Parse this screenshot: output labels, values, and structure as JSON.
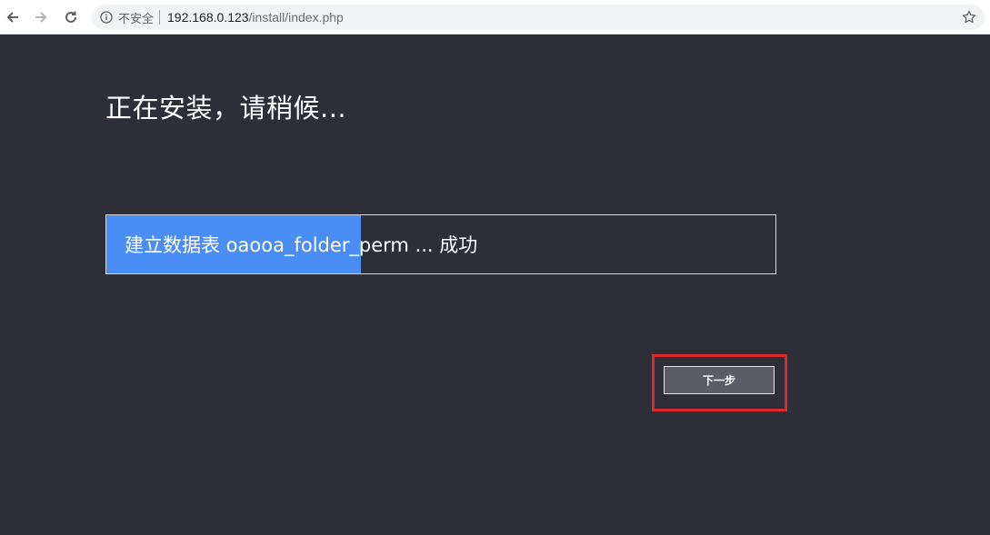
{
  "browser": {
    "security_label": "不安全",
    "url_host": "192.168.0.123",
    "url_path": "/install/index.php"
  },
  "install": {
    "title": "正在安装，请稍候...",
    "progress_text": "建立数据表 oaooa_folder_perm ... 成功",
    "progress_fraction": 0.38,
    "next_button_label": "下一步"
  },
  "colors": {
    "page_bg": "#2d2e38",
    "progress_fill": "#4a8ef5",
    "highlight": "#e0282c"
  }
}
